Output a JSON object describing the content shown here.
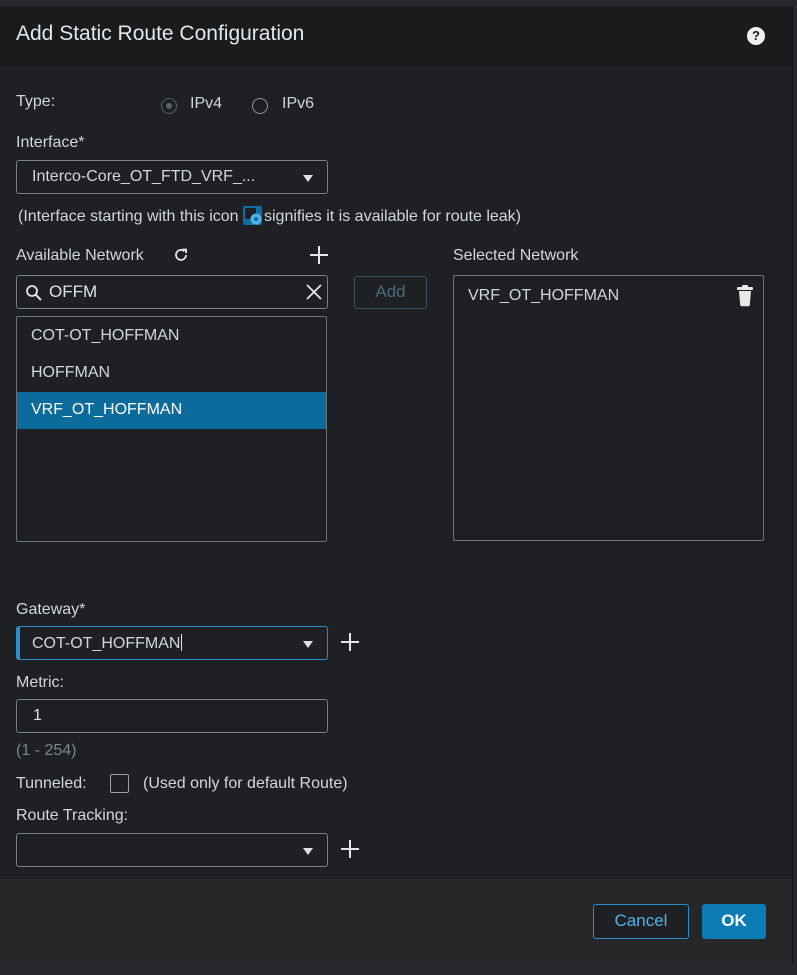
{
  "dialog": {
    "title": "Add Static Route Configuration",
    "help_icon": "?",
    "help_icon_name": "question-circle-icon"
  },
  "type": {
    "label": "Type:",
    "options": [
      "IPv4",
      "IPv6"
    ],
    "selected": "IPv4"
  },
  "interface": {
    "label": "Interface*",
    "value": "Interco-Core_OT_FTD_VRF_...",
    "hint_before": "(Interface starting with this icon ",
    "hint_after": "signifies it is available for route leak)",
    "hint_icon": "route-leak-icon"
  },
  "available_network": {
    "label": "Available Network",
    "refresh_icon": "↻",
    "search_value": "OFFM",
    "search_icon": "⚲",
    "clear_icon": "✕",
    "items": [
      "COT-OT_HOFFMAN",
      "HOFFMAN",
      "VRF_OT_HOFFMAN"
    ],
    "selected_index": 2
  },
  "add_button": "Add",
  "selected_network": {
    "label": "Selected Network",
    "items": [
      "VRF_OT_HOFFMAN"
    ],
    "delete_icon": "trash-icon"
  },
  "gateway": {
    "label": "Gateway*",
    "value": "COT-OT_HOFFMAN"
  },
  "metric": {
    "label": "Metric:",
    "value": "1",
    "range": "(1 - 254)"
  },
  "tunneled": {
    "label": "Tunneled:",
    "note": "(Used only for default Route)",
    "checked": false
  },
  "route_tracking": {
    "label": "Route Tracking:",
    "value": ""
  },
  "footer": {
    "cancel": "Cancel",
    "ok": "OK"
  },
  "colors": {
    "accent": "#0b6b9a",
    "ok_button": "#0c7bb3",
    "focus_border": "#2a8fc7"
  }
}
